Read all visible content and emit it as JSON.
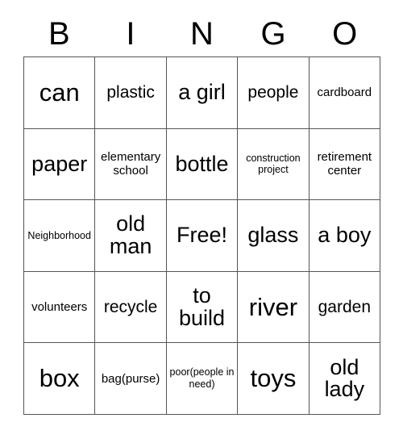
{
  "card": {
    "title": "BINGO",
    "header_letters": [
      "B",
      "I",
      "N",
      "G",
      "O"
    ],
    "free_space_label": "Free!",
    "grid_size": "5x5",
    "text_color": "#000000",
    "border_color": "#555555",
    "background_color": "#ffffff",
    "rows": [
      {
        "cells": [
          {
            "text": "can",
            "size": "sz-xl"
          },
          {
            "text": "plastic",
            "size": "sz-md"
          },
          {
            "text": "a girl",
            "size": "sz-lg"
          },
          {
            "text": "people",
            "size": "sz-md"
          },
          {
            "text": "cardboard",
            "size": "sz-sm"
          }
        ]
      },
      {
        "cells": [
          {
            "text": "paper",
            "size": "sz-lg"
          },
          {
            "text": "elementary school",
            "size": "sz-sm"
          },
          {
            "text": "bottle",
            "size": "sz-lg"
          },
          {
            "text": "construction project",
            "size": "sz-xs"
          },
          {
            "text": "retirement center",
            "size": "sz-sm"
          }
        ]
      },
      {
        "cells": [
          {
            "text": "Neighborhood",
            "size": "sz-xs"
          },
          {
            "text": "old man",
            "size": "sz-lg"
          },
          {
            "text": "Free!",
            "size": "sz-lg"
          },
          {
            "text": "glass",
            "size": "sz-lg"
          },
          {
            "text": "a boy",
            "size": "sz-lg"
          }
        ]
      },
      {
        "cells": [
          {
            "text": "volunteers",
            "size": "sz-sm"
          },
          {
            "text": "recycle",
            "size": "sz-md"
          },
          {
            "text": "to build",
            "size": "sz-lg"
          },
          {
            "text": "river",
            "size": "sz-xl"
          },
          {
            "text": "garden",
            "size": "sz-md"
          }
        ]
      },
      {
        "cells": [
          {
            "text": "box",
            "size": "sz-xl"
          },
          {
            "text": "bag(purse)",
            "size": "sz-sm"
          },
          {
            "text": "poor(people in need)",
            "size": "sz-xs"
          },
          {
            "text": "toys",
            "size": "sz-xl"
          },
          {
            "text": "old lady",
            "size": "sz-lg"
          }
        ]
      }
    ]
  }
}
